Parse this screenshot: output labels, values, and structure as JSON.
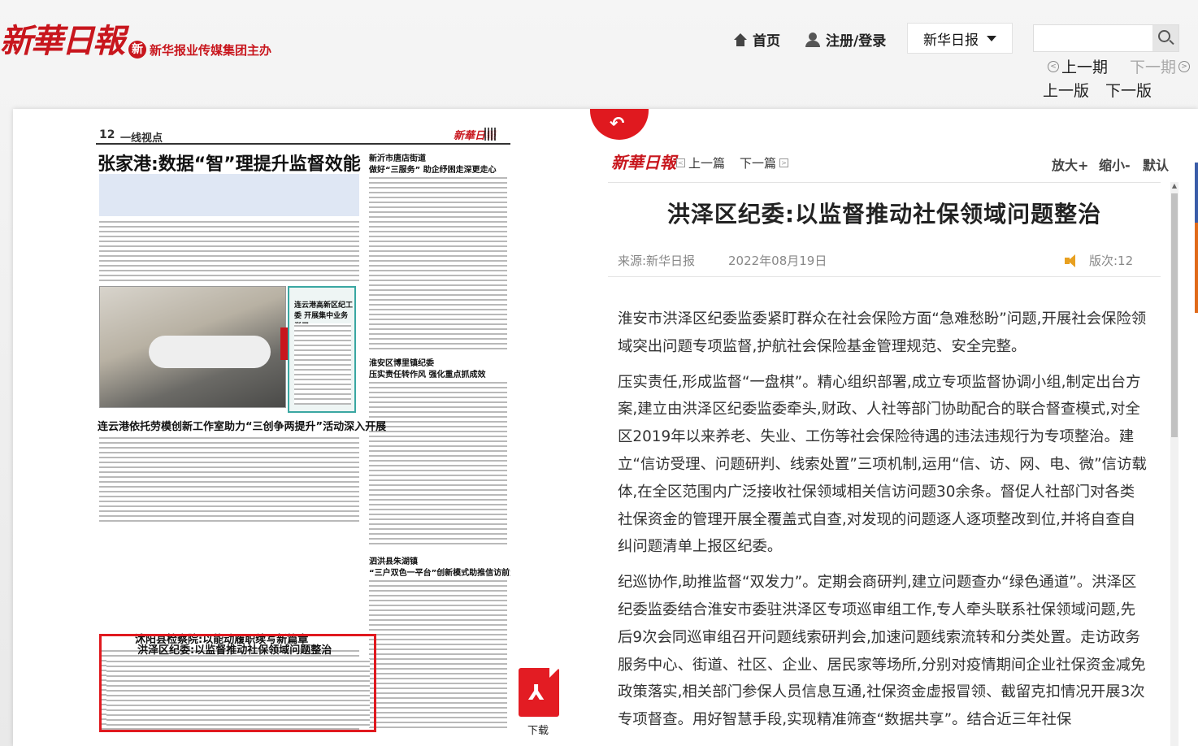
{
  "header": {
    "logo_text": "新華日報",
    "sponsor_mark": "新",
    "sponsor": "新华报业传媒集团主办",
    "home": "首页",
    "login": "注册/登录",
    "paper_select": "新华日报",
    "search_placeholder": "",
    "prev_issue": "上一期",
    "next_issue": "下一期",
    "prev_edition": "上一版",
    "next_edition": "下一版"
  },
  "newspaper": {
    "page_no": "12",
    "section": "一线视点",
    "logo": "新華日報",
    "headline1": "张家港:数据“智”理提升监督效能",
    "side1_kicker": "新沂市唐店街道",
    "side1_title": "做好“三服务” 助企纾困走深更走心",
    "panel_title": "连云港高新区纪工委 开展集中业务学习",
    "side2_kicker": "淮安区博里镇纪委",
    "side2_title": "压实责任转作风 强化重点抓成效",
    "headline2": "连云港依托劳模创新工作室助力“三创争两提升”活动深入开展",
    "highlight_title": "洪泽区纪委:以监督推动社保领域问题整治",
    "side3_kicker": "泗洪县朱湖镇",
    "side3_title": "“三户双色一平台”创新模式助推信访前置“治未病”",
    "headline3": "沭阳县检察院:以能动履职续写新篇章"
  },
  "download": {
    "label": "下载",
    "glyph": "⅄"
  },
  "article": {
    "logo": "新華日報",
    "prev": "上一篇",
    "next": "下一篇",
    "zoom_in": "放大+",
    "zoom_out": "缩小-",
    "zoom_reset": "默认",
    "title": "洪泽区纪委:以监督推动社保领域问题整治",
    "source": "来源:新华日报",
    "date": "2022年08月19日",
    "page": "版次:12",
    "paragraphs": [
      "淮安市洪泽区纪委监委紧盯群众在社会保险方面“急难愁盼”问题,开展社会保险领域突出问题专项监督,护航社会保险基金管理规范、安全完整。",
      "压实责任,形成监督“一盘棋”。精心组织部署,成立专项监督协调小组,制定出台方案,建立由洪泽区纪委监委牵头,财政、人社等部门协助配合的联合督查模式,对全区2019年以来养老、失业、工伤等社会保险待遇的违法违规行为专项整治。建立“信访受理、问题研判、线索处置”三项机制,运用“信、访、网、电、微”信访载体,在全区范围内广泛接收社保领域相关信访问题30余条。督促人社部门对各类社保资金的管理开展全覆盖式自查,对发现的问题逐人逐项整改到位,并将自查自纠问题清单上报区纪委。",
      "纪巡协作,助推监督“双发力”。定期会商研判,建立问题查办“绿色通道”。洪泽区纪委监委结合淮安市委驻洪泽区专项巡审组工作,专人牵头联系社保领域问题,先后9次会同巡审组召开问题线索研判会,加速问题线索流转和分类处置。走访政务服务中心、街道、社区、企业、居民家等场所,分别对疫情期间企业社保资金减免政策落实,相关部门参保人员信息互通,社保资金虚报冒领、截留克扣情况开展3次专项督查。用好智慧手段,实现精准筛查“数据共享”。结合近三年社保"
    ]
  }
}
